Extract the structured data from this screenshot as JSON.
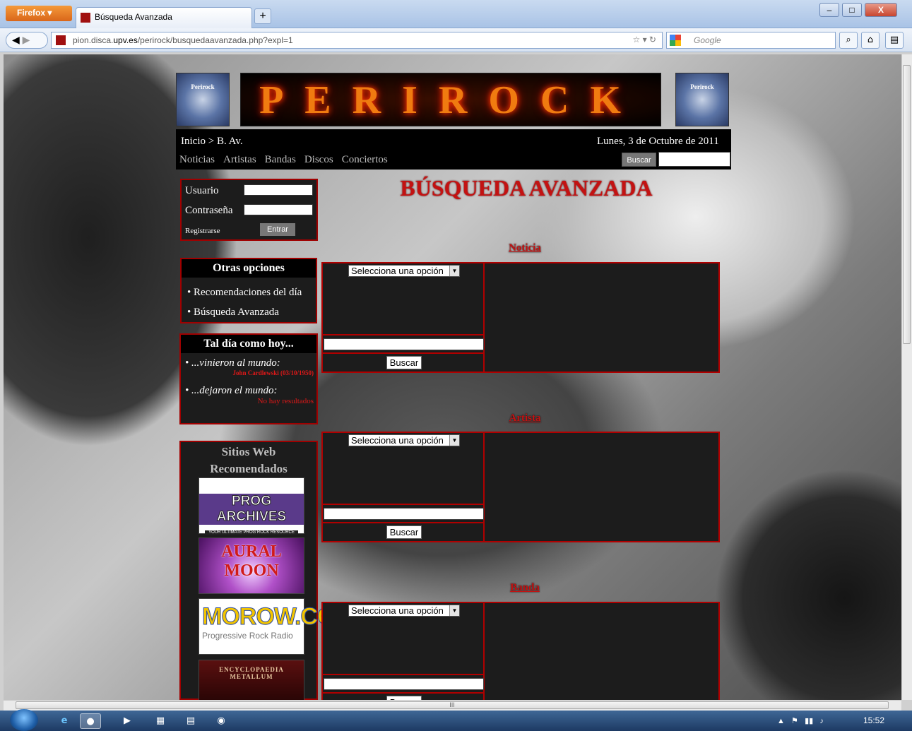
{
  "browser": {
    "app_button": "Firefox ▾",
    "tab_title": "Búsqueda Avanzada",
    "new_tab": "+",
    "url_prefix": "pion.disca.",
    "url_domain": "upv.es",
    "url_path": "/perirock/busquedaavanzada.php?expl=1",
    "search_engine_placeholder": "Google",
    "min": "–",
    "max": "□",
    "close": "X"
  },
  "site": {
    "logo_text": "Perirock",
    "banner_text": "PERIROCK",
    "breadcrumb": "Inicio > B. Av.",
    "date": "Lunes, 3 de Octubre de 2011",
    "nav": [
      "Noticias",
      "Artistas",
      "Bandas",
      "Discos",
      "Conciertos"
    ],
    "top_search_button": "Buscar",
    "login": {
      "user_label": "Usuario",
      "pass_label": "Contraseña",
      "register": "Registrarse",
      "enter": "Entrar"
    },
    "other_options": {
      "title": "Otras opciones",
      "items": [
        "Recomendaciones del día",
        "Búsqueda Avanzada"
      ]
    },
    "this_day": {
      "title": "Tal día como hoy...",
      "born_label": "...vinieron al mundo:",
      "born_value": "John Cardlewski (03/10/1950)",
      "died_label": "...dejaron el mundo:",
      "died_value": "No hay resultados"
    },
    "recommended": {
      "title_line1": "Sitios Web",
      "title_line2": "Recomendados",
      "sites": [
        "PROG ARCHIVES",
        "AURAL MOON",
        "MOROW.COM",
        "ENCYCLOPAEDIA METALLUM"
      ],
      "site_sub": [
        "YOUR ULTIMATE PROG ROCK RESOURCE",
        "",
        "Progressive Rock Radio",
        ""
      ]
    },
    "page_title": "BÚSQUEDA AVANZADA",
    "sections": [
      {
        "title": "Noticia",
        "select": "Selecciona una opción",
        "button": "Buscar"
      },
      {
        "title": "Artista",
        "select": "Selecciona una opción",
        "button": "Buscar"
      },
      {
        "title": "Banda",
        "select": "Selecciona una opción",
        "button": "Buscar"
      }
    ]
  },
  "taskbar": {
    "clock": "15:52",
    "hscroll_grip": "III"
  },
  "colors": {
    "accent_red": "#c31212",
    "panel_bg": "#1c1c1c"
  }
}
